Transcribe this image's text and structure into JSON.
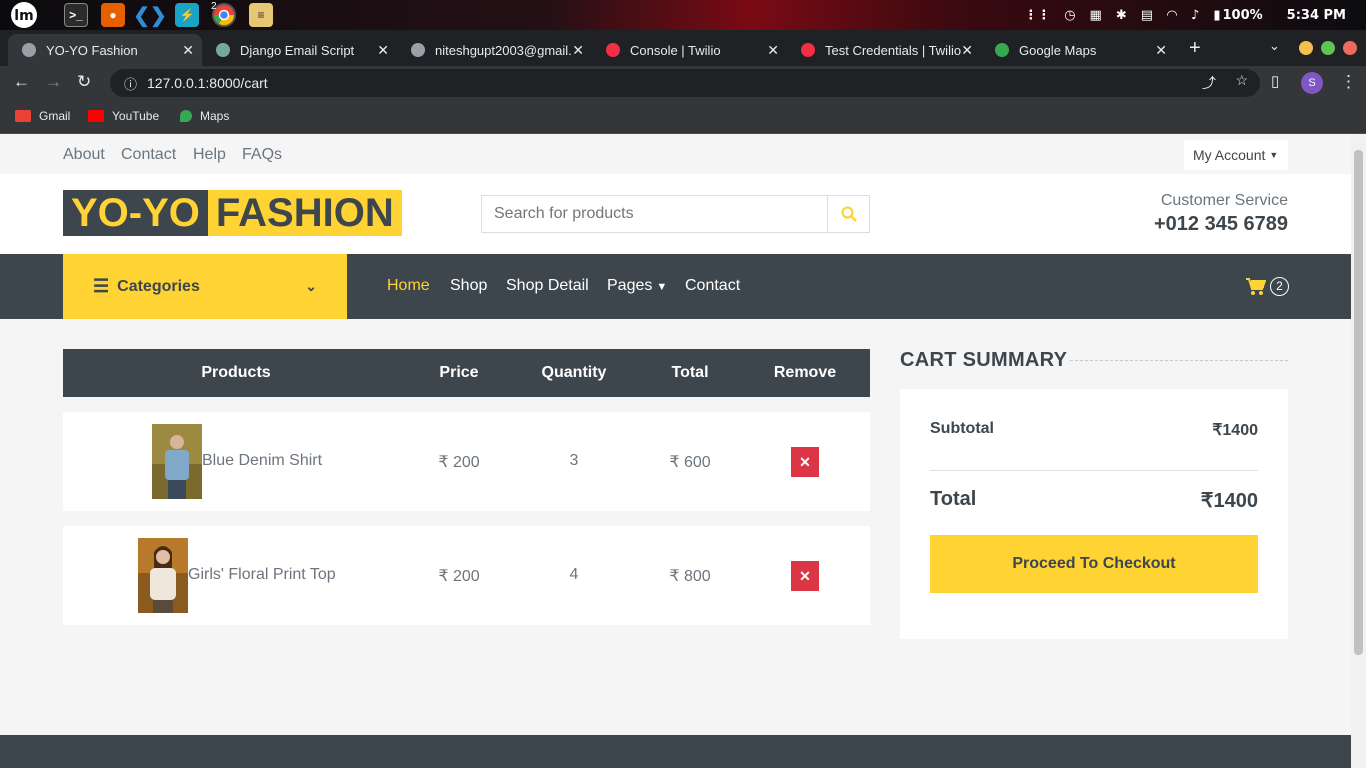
{
  "system": {
    "battery": "100%",
    "time": "5:34 PM",
    "chrome_badge": "2"
  },
  "browser": {
    "tabs": [
      {
        "title": "YO-YO Fashion",
        "color": "#9aa0a6"
      },
      {
        "title": "Django Email Script",
        "color": "#74aa9c"
      },
      {
        "title": "niteshgupt2003@gmail.",
        "color": "#9aa0a6"
      },
      {
        "title": "Console | Twilio",
        "color": "#f22f46"
      },
      {
        "title": "Test Credentials | Twilio",
        "color": "#f22f46"
      },
      {
        "title": "Google Maps",
        "color": "#34a853"
      }
    ],
    "url": "127.0.0.1:8000/cart",
    "profile_initial": "S",
    "bookmarks": [
      "Gmail",
      "YouTube",
      "Maps"
    ]
  },
  "topbar": {
    "links": [
      "About",
      "Contact",
      "Help",
      "FAQs"
    ],
    "account": "My Account"
  },
  "header": {
    "logo_part1": "YO-YO",
    "logo_part2": "FASHION",
    "search_placeholder": "Search for products",
    "cs_label": "Customer Service",
    "cs_phone": "+012 345 6789"
  },
  "nav": {
    "categories": "Categories",
    "links": [
      "Home",
      "Shop",
      "Shop Detail",
      "Pages",
      "Contact"
    ],
    "cart_count": "2"
  },
  "cart": {
    "headers": [
      "Products",
      "Price",
      "Quantity",
      "Total",
      "Remove"
    ],
    "rows": [
      {
        "name": "Blue Denim Shirt",
        "price": "₹ 200",
        "qty": "3",
        "total": "₹ 600"
      },
      {
        "name": "Girls' Floral Print Top",
        "price": "₹ 200",
        "qty": "4",
        "total": "₹ 800"
      }
    ]
  },
  "summary": {
    "title": "CART SUMMARY",
    "subtotal_label": "Subtotal",
    "subtotal_value": "₹1400",
    "total_label": "Total",
    "total_value": "₹1400",
    "checkout": "Proceed To Checkout"
  },
  "colors": {
    "accent": "#ffd333",
    "dark": "#3d464d",
    "danger": "#dc3545"
  }
}
